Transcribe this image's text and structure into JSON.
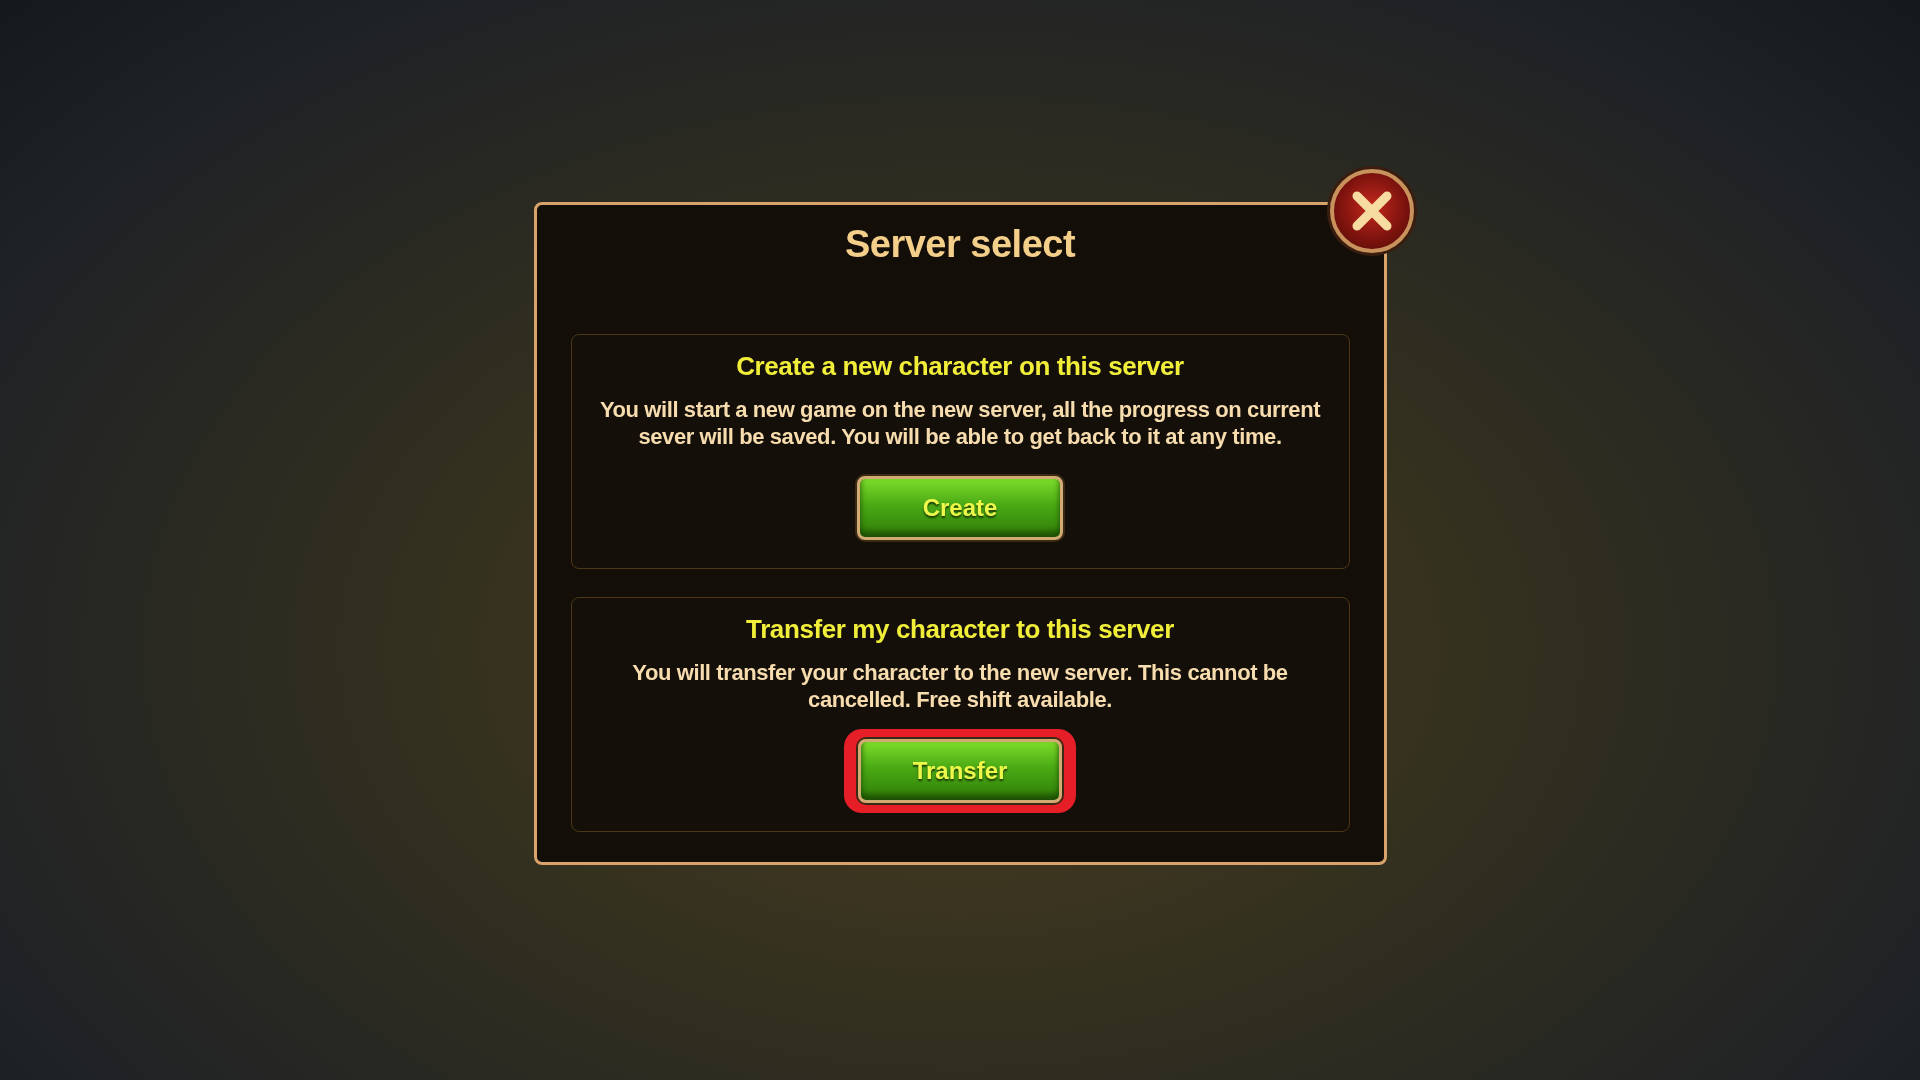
{
  "dialog": {
    "title": "Server select"
  },
  "options": [
    {
      "heading": "Create a new character on this server",
      "description": "You will start a new game on the new server, all the progress on current sever will be saved. You will be able to get back to it at any time.",
      "button": "Create",
      "highlighted": false
    },
    {
      "heading": "Transfer my character to this server",
      "description": "You will transfer your character to the new server. This cannot be cancelled. Free shift available.",
      "button": "Transfer",
      "highlighted": true
    }
  ]
}
